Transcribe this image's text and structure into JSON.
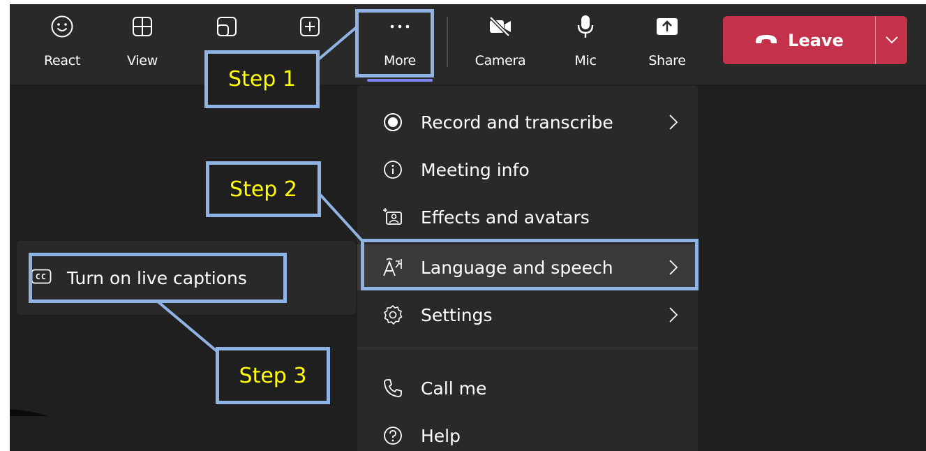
{
  "toolbar": {
    "react_label": "React",
    "view_label": "View",
    "more_label": "More",
    "camera_label": "Camera",
    "mic_label": "Mic",
    "share_label": "Share",
    "leave_label": "Leave"
  },
  "more_menu": {
    "items": [
      {
        "label": "Record and transcribe",
        "icon": "record-icon"
      },
      {
        "label": "Meeting info",
        "icon": "info-icon"
      },
      {
        "label": "Effects and avatars",
        "icon": "effects-icon"
      },
      {
        "label": "Language and speech",
        "icon": "language-icon"
      },
      {
        "label": "Settings",
        "icon": "gear-icon"
      },
      {
        "label": "Call me",
        "icon": "phone-icon"
      },
      {
        "label": "Help",
        "icon": "help-icon"
      }
    ]
  },
  "submenu": {
    "live_captions_label": "Turn on live captions"
  },
  "annotations": {
    "step1": "Step 1",
    "step2": "Step 2",
    "step3": "Step 3"
  },
  "colors": {
    "leave": "#c4314b",
    "accent": "#7f85f5",
    "callout_border": "#8fb4e3",
    "callout_text": "#ffff00"
  }
}
